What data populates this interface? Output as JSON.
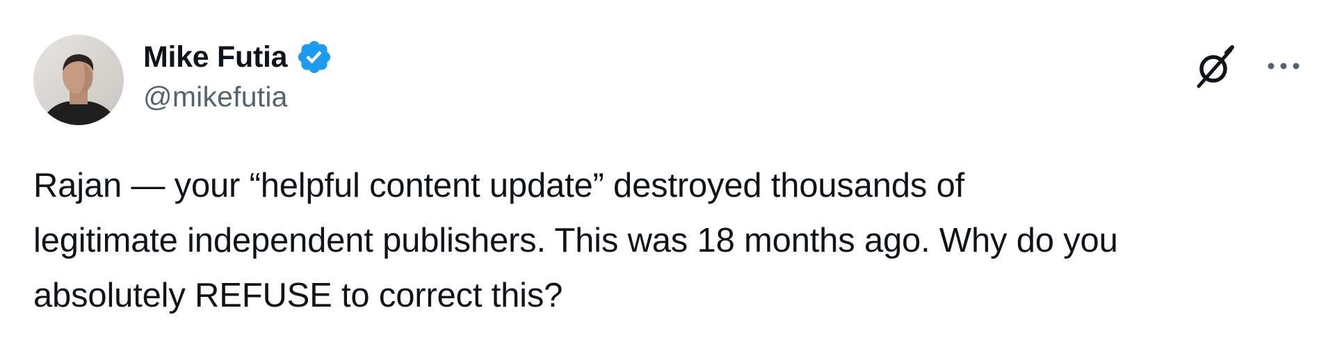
{
  "author": {
    "display_name": "Mike Futia",
    "handle": "@mikefutia",
    "verified": true,
    "verified_icon": "verified-badge-icon",
    "verified_color": "#1d9bf0"
  },
  "actions": {
    "grok_icon": "grok-icon",
    "more_icon": "more-options-icon"
  },
  "tweet": {
    "text": "Rajan — your “helpful content update” destroyed thousands of\nlegitimate independent publishers. This was 18 months ago. Why do you\nabsolutely REFUSE to correct this?"
  },
  "colors": {
    "text_primary": "#0f1419",
    "text_secondary": "#536471",
    "accent": "#1d9bf0"
  }
}
